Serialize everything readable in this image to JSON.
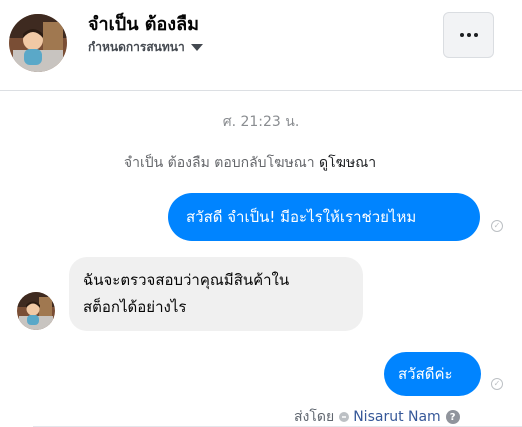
{
  "header": {
    "name": "จำเป็น ต้องลืม",
    "manage_label": "กำหนดการสนทนา",
    "caret_icon": "caret-down-icon",
    "more_icon": "more-dots-icon"
  },
  "chat": {
    "timestamp": "ศ. 21:23 น.",
    "notice_text": "จำเป็น ต้องลืม ตอบกลับโฆษณา",
    "notice_link": "ดูโฆษณา",
    "messages": [
      {
        "from": "page",
        "text": "สวัสดี จำเป็น! มีอะไรให้เราช่วยไหม"
      },
      {
        "from": "user",
        "lines": [
          "ฉันจะตรวจสอบว่าคุณมีสินค้าใน",
          "สต็อกได้อย่างไร"
        ]
      },
      {
        "from": "page",
        "text": "สวัสดีค่ะ"
      }
    ],
    "sent_by_label": "ส่งโดย",
    "sent_by_name": "Nisarut Nam",
    "help_icon_text": "?"
  },
  "colors": {
    "outgoing_bubble": "#0084ff",
    "incoming_bubble": "#f0f0f0",
    "link": "#365899"
  }
}
